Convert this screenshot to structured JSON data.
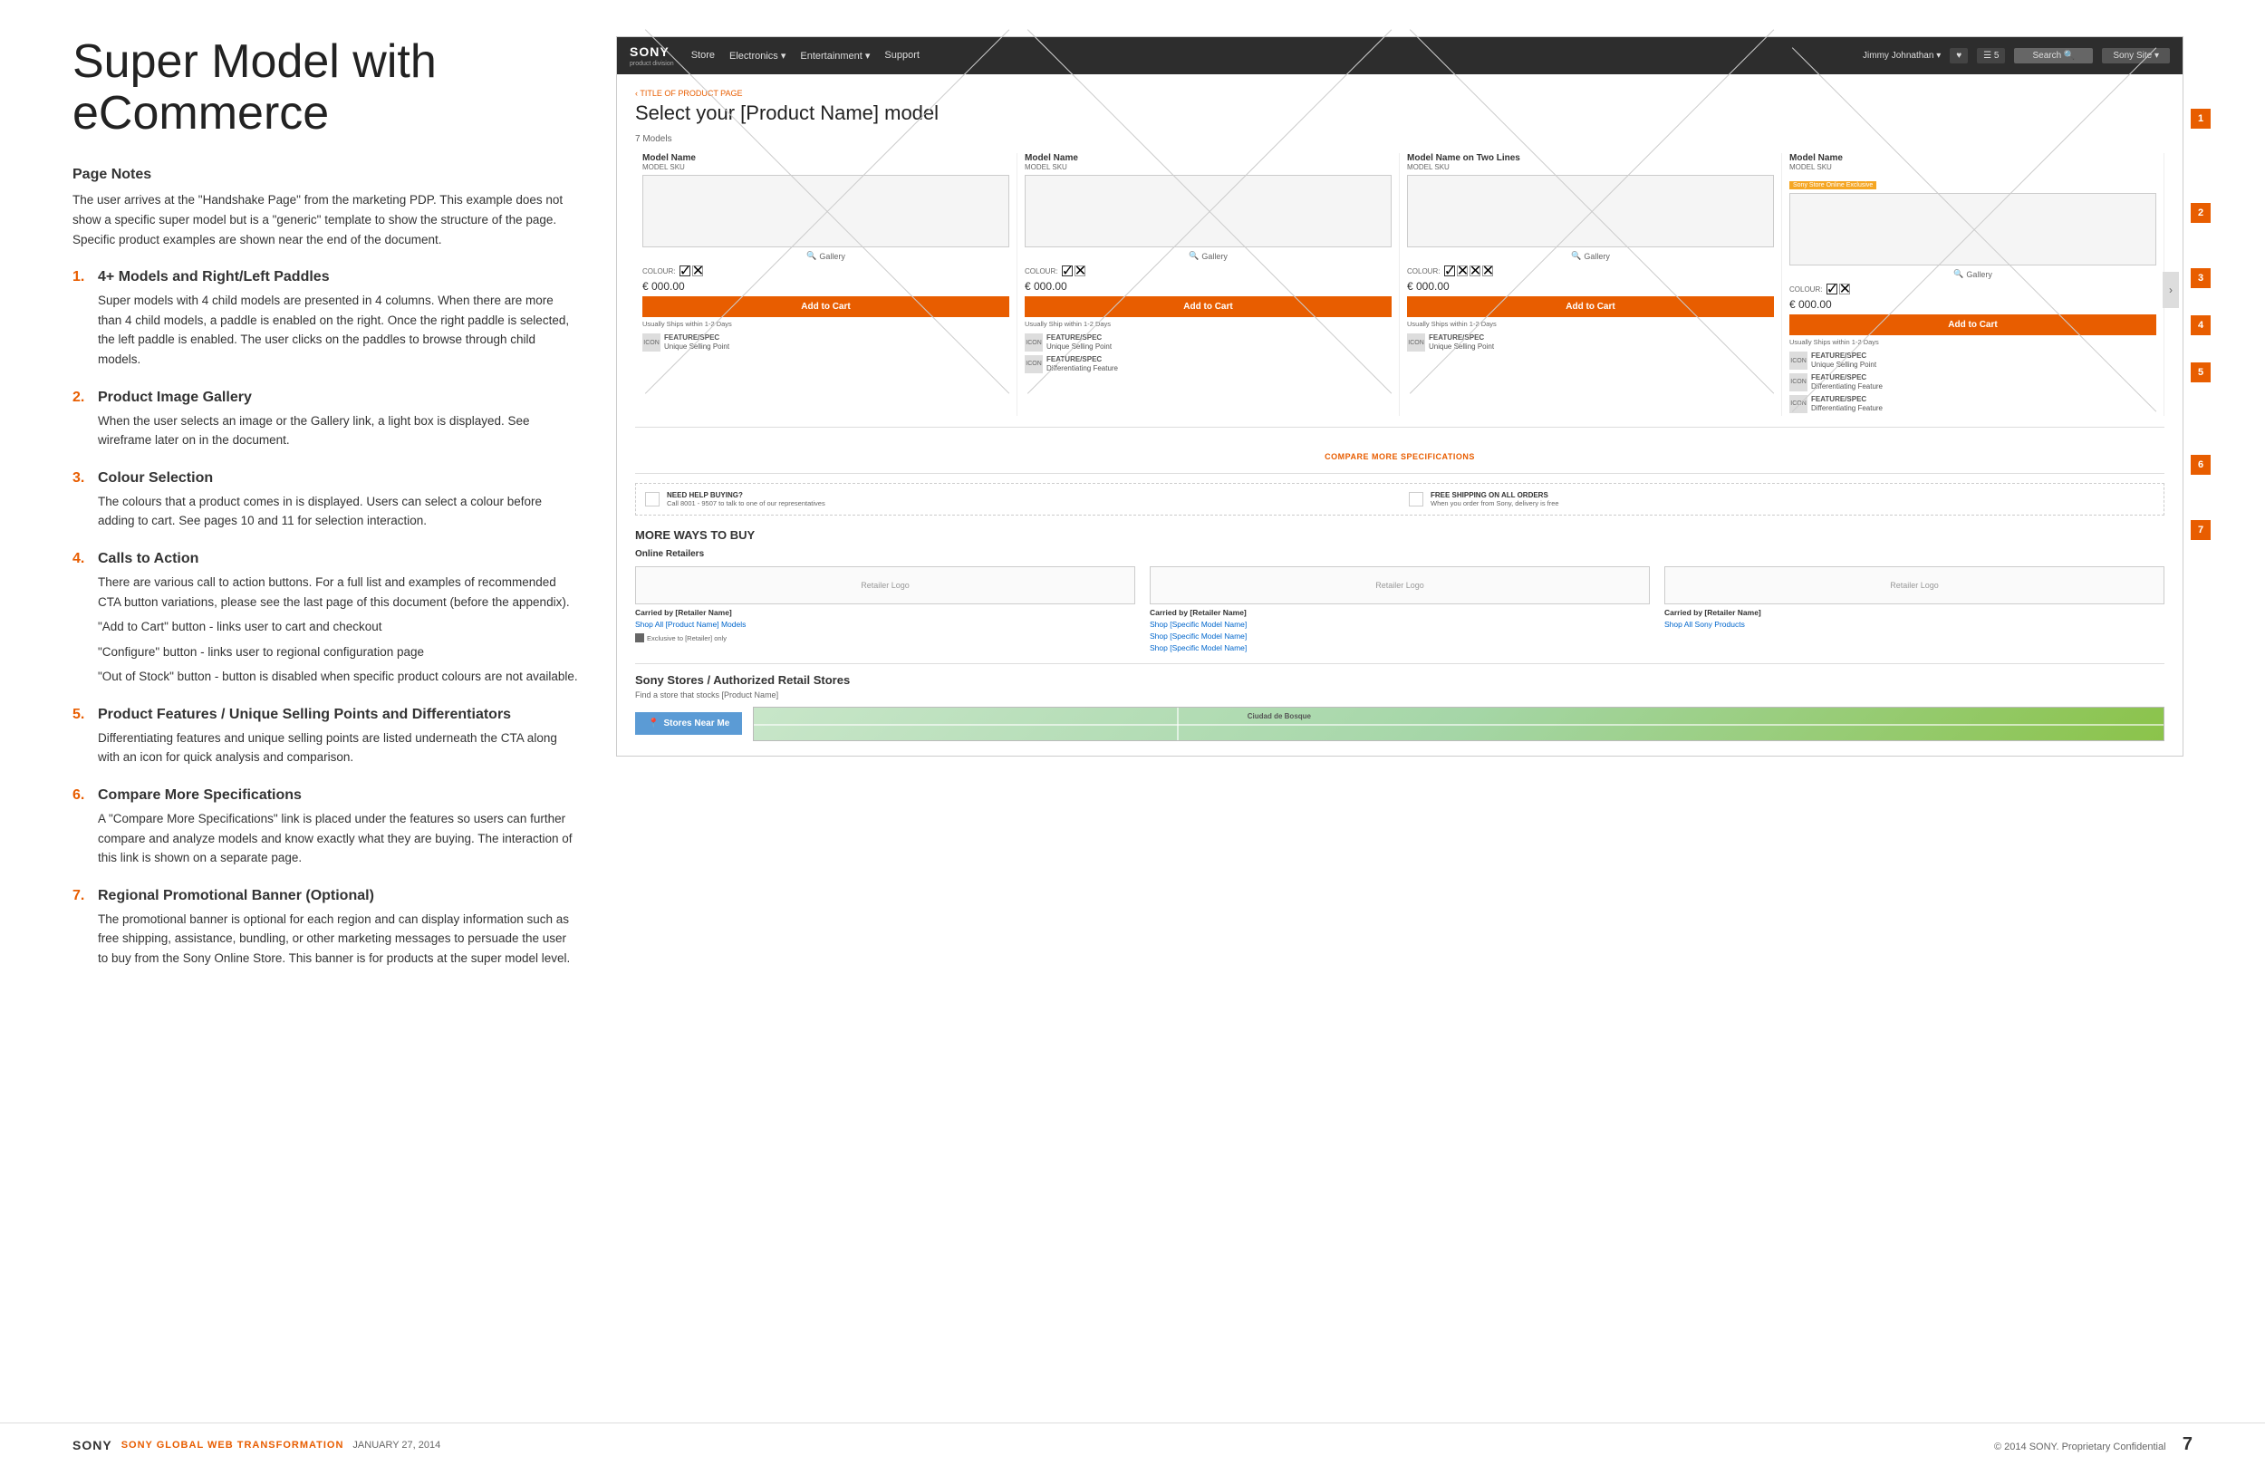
{
  "page": {
    "title": "Super Model with eCommerce"
  },
  "left": {
    "page_notes_heading": "Page Notes",
    "page_notes_text": "The user arrives at the \"Handshake Page\" from the marketing PDP. This example does not show a specific super model but is a \"generic\" template to show the structure of the page. Specific product examples are shown near the end of the document.",
    "sections": [
      {
        "num": "1.",
        "title": "4+ Models and Right/Left Paddles",
        "desc": "Super models with 4 child models are presented in 4 columns. When there are more than 4 child models, a paddle is enabled on the right. Once the right paddle is selected, the left paddle is enabled. The user clicks on the paddles to browse through child models."
      },
      {
        "num": "2.",
        "title": "Product Image Gallery",
        "desc": "When the user selects an image or the Gallery link, a light box is displayed. See wireframe later on in the document."
      },
      {
        "num": "3.",
        "title": "Colour Selection",
        "desc": "The colours that a product comes in is displayed. Users can select a colour before adding to cart. See pages 10 and 11 for selection interaction."
      },
      {
        "num": "4.",
        "title": "Calls to Action",
        "desc": "There are various call to action buttons. For a full list and examples of recommended CTA button variations, please see the last page of this document (before the appendix).",
        "bullets": [
          "\"Add to Cart\" button - links user to cart and checkout",
          "\"Configure\" button - links user to regional configuration page",
          "\"Out of Stock\" button - button is disabled when specific product colours are not available."
        ]
      },
      {
        "num": "5.",
        "title": "Product Features / Unique Selling Points and Differentiators",
        "desc": "Differentiating features and unique selling points are listed underneath the CTA along with an icon for quick analysis and comparison."
      },
      {
        "num": "6.",
        "title": "Compare More Specifications",
        "desc": "A \"Compare More Specifications\" link is placed under the features so users can further compare and analyze models and know exactly what they are buying. The interaction of this link is shown on a separate page."
      },
      {
        "num": "7.",
        "title": "Regional Promotional Banner (Optional)",
        "desc": "The promotional banner is optional for each region and can display information such as free shipping, assistance, bundling, or other marketing messages to persuade the user to buy from the Sony Online Store. This banner is for products at the super model level."
      }
    ]
  },
  "wireframe": {
    "nav": {
      "brand": "SONY",
      "brand_sub": "product division",
      "links": [
        "Store",
        "Electronics ▾",
        "Entertainment ▾",
        "Support"
      ],
      "user": "Jimmy Johnathan ▾",
      "wishlist": "♥",
      "cart": "☰ 5",
      "search": "Search 🔍",
      "sony_site": "Sony Site ▾"
    },
    "breadcrumb": "‹ TITLE OF PRODUCT PAGE",
    "page_title": "Select your [Product Name] model",
    "models_count": "7 Models",
    "models": [
      {
        "name": "Model Name",
        "sku": "MODEL SKU",
        "exclusive": null,
        "price": "€ 000.00",
        "add_to_cart": "Add to Cart",
        "ships": "Usually Ships within 1-2 Days",
        "features": [
          {
            "icon": "ICON",
            "bold": "FEATURE/SPEC",
            "text": "Unique Selling Point"
          }
        ]
      },
      {
        "name": "Model Name",
        "sku": "MODEL SKU",
        "exclusive": null,
        "price": "€ 000.00",
        "add_to_cart": "Add to Cart",
        "ships": "Usually Ship within 1-2 Days",
        "features": [
          {
            "icon": "ICON",
            "bold": "FEATURE/SPEC",
            "text": "Unique Selling Point"
          },
          {
            "icon": "ICON",
            "bold": "FEATURE/SPEC",
            "text": "Differentiating Feature"
          }
        ]
      },
      {
        "name": "Model Name on Two Lines",
        "sku": "MODEL SKU",
        "exclusive": null,
        "price": "€ 000.00",
        "add_to_cart": "Add to Cart",
        "ships": "Usually Ships within 1-2 Days",
        "features": [
          {
            "icon": "ICON",
            "bold": "FEATURE/SPEC",
            "text": "Unique Selling Point"
          }
        ]
      },
      {
        "name": "Model Name",
        "sku": "MODEL SKU",
        "exclusive": "Sony Store Online Exclusive",
        "price": "€ 000.00",
        "add_to_cart": "Add to Cart",
        "ships": "Usually Ships within 1-2 Days",
        "features": [
          {
            "icon": "ICON",
            "bold": "FEATURE/SPEC",
            "text": "Unique Selling Point"
          },
          {
            "icon": "ICON",
            "bold": "FEATURE/SPEC",
            "text": "Differentiating Feature"
          },
          {
            "icon": "ICON",
            "bold": "FEATURE/SPEC",
            "text": "Differentiating Feature"
          }
        ]
      }
    ],
    "gallery_label": "Gallery",
    "colour_label": "COLOUR:",
    "compare_link": "COMPARE MORE SPECIFICATIONS",
    "promo_banners": [
      {
        "title": "NEED HELP BUYING?",
        "desc": "Call 8001 - 9507 to talk to one of our representatives"
      },
      {
        "title": "FREE SHIPPING ON ALL ORDERS",
        "desc": "When you order from Sony, delivery is free"
      }
    ],
    "more_ways_title": "MORE WAYS TO BUY",
    "online_retailers_label": "Online Retailers",
    "retailers": [
      {
        "logo": "Retailer Logo",
        "carried_by": "Carried by [Retailer Name]",
        "links": [
          "Shop All [Product Name] Models"
        ],
        "exclusive_label": "Exclusive to [Retailer] only"
      },
      {
        "logo": "Retailer Logo",
        "carried_by": "Carried by [Retailer Name]",
        "links": [
          "Shop [Specific Model Name]",
          "Shop [Specific Model Name]",
          "Shop [Specific Model Name]"
        ]
      },
      {
        "logo": "Retailer Logo",
        "carried_by": "Carried by [Retailer Name]",
        "links": [
          "Shop All Sony Products"
        ]
      }
    ],
    "stores_title": "Sony Stores / Authorized Retail Stores",
    "stores_desc": "Find a store that stocks [Product Name]",
    "stores_near_btn": "Stores Near Me",
    "map_label": "Ciudad de Bosque"
  },
  "annotation_nums": [
    "1",
    "2",
    "3",
    "4",
    "5",
    "6",
    "7"
  ],
  "footer": {
    "brand": "SONY",
    "subtitle": "SONY GLOBAL WEB TRANSFORMATION",
    "date": "JANUARY 27, 2014",
    "copyright": "© 2014 SONY. Proprietary Confidential",
    "page_num": "7"
  }
}
